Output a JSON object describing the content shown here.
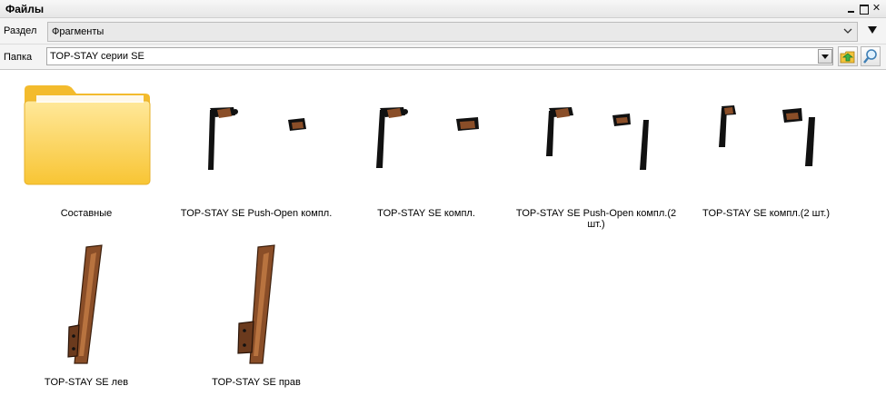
{
  "window": {
    "title": "Файлы"
  },
  "section": {
    "label": "Раздел",
    "value": "Фрагменты"
  },
  "folder": {
    "label": "Папка",
    "value": "TOP-STAY серии SE"
  },
  "items": [
    {
      "caption": "Составные",
      "icon": "folder-icon"
    },
    {
      "caption": "TOP-STAY SE  Push-Open компл.",
      "icon": "fragment-thumbnail"
    },
    {
      "caption": "TOP-STAY SE  компл.",
      "icon": "fragment-thumbnail"
    },
    {
      "caption": "TOP-STAY SE Push-Open компл.(2 шт.)",
      "icon": "fragment-thumbnail"
    },
    {
      "caption": "TOP-STAY SE компл.(2 шт.)",
      "icon": "fragment-thumbnail"
    },
    {
      "caption": "TOP-STAY SE лев",
      "icon": "fragment-thumbnail"
    },
    {
      "caption": "TOP-STAY SE прав",
      "icon": "fragment-thumbnail"
    }
  ],
  "colors": {
    "folder": "#f6c744",
    "wood": "#8a4e28",
    "black": "#111111"
  }
}
